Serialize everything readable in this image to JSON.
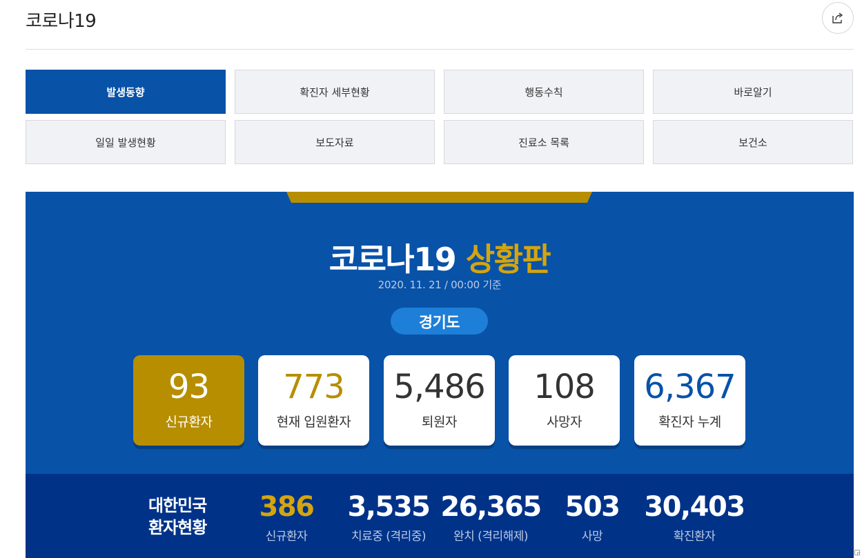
{
  "header": {
    "title": "코로나19",
    "share_icon": "share-icon"
  },
  "tabs": [
    {
      "label": "발생동향",
      "active": true
    },
    {
      "label": "확진자 세부현황",
      "active": false
    },
    {
      "label": "행동수칙",
      "active": false
    },
    {
      "label": "바로알기",
      "active": false
    },
    {
      "label": "일일 발생현황",
      "active": false
    },
    {
      "label": "보도자료",
      "active": false
    },
    {
      "label": "진료소 목록",
      "active": false
    },
    {
      "label": "보건소",
      "active": false
    }
  ],
  "board": {
    "title_main": "코로나19",
    "title_accent": "상황판",
    "date": "2020. 11. 21 / 00:00 기준",
    "region": "경기도",
    "cards": [
      {
        "value": "93",
        "label": "신규환자"
      },
      {
        "value": "773",
        "label": "현재 입원환자"
      },
      {
        "value": "5,486",
        "label": "퇴원자"
      },
      {
        "value": "108",
        "label": "사망자"
      },
      {
        "value": "6,367",
        "label": "확진자 누계"
      }
    ]
  },
  "national": {
    "title_line1": "대한민국",
    "title_line2": "환자현황",
    "stats": [
      {
        "value": "386",
        "label": "신규환자"
      },
      {
        "value": "3,535",
        "label": "치료중 (격리중)"
      },
      {
        "value": "26,365",
        "label": "완치 (격리해제)"
      },
      {
        "value": "503",
        "label": "사망"
      },
      {
        "value": "30,403",
        "label": "확진환자"
      }
    ]
  },
  "colors": {
    "primary_blue": "#0852a8",
    "dark_blue": "#003288",
    "gold": "#b78e00",
    "badge_blue": "#1e7fd8"
  }
}
